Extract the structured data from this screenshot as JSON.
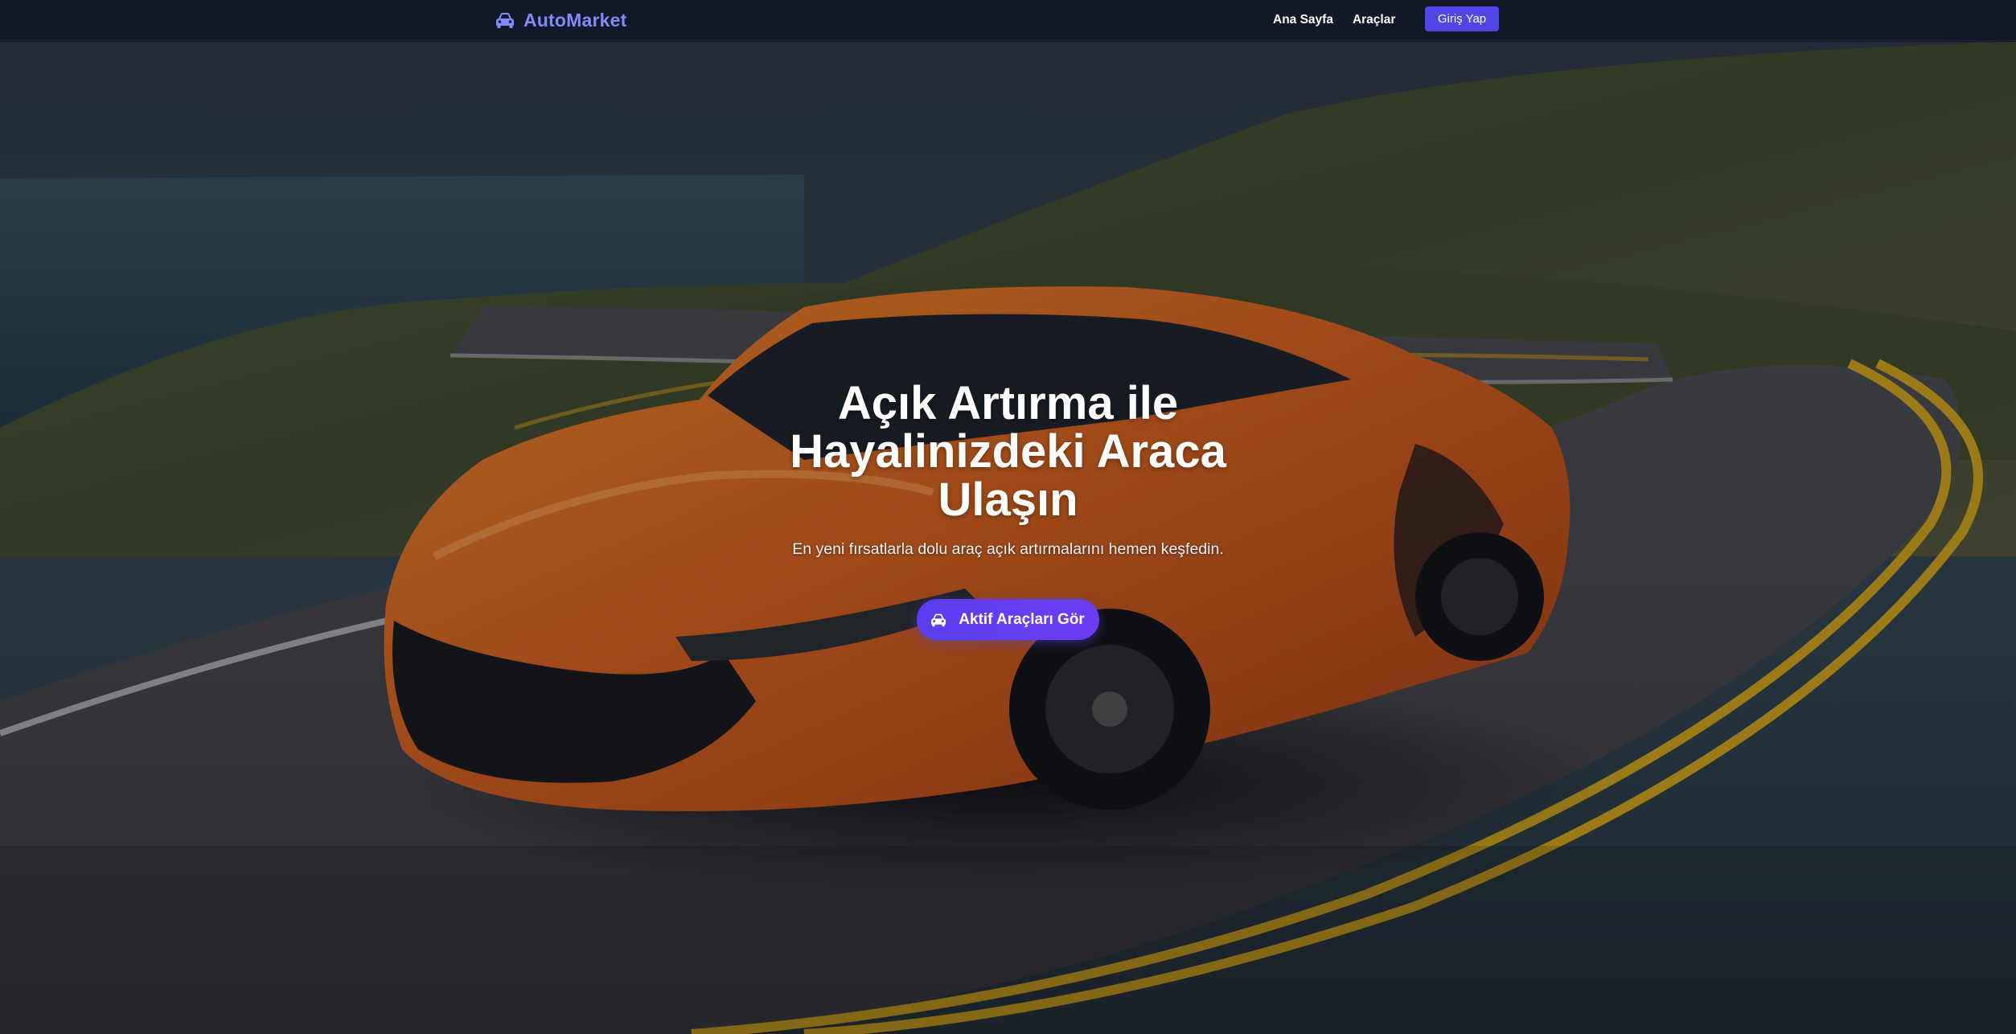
{
  "navbar": {
    "brand": {
      "icon": "car-icon",
      "name": "AutoMarket"
    },
    "links": [
      {
        "label": "Ana Sayfa"
      },
      {
        "label": "Araçlar"
      }
    ],
    "login_label": "Giriş Yap"
  },
  "hero": {
    "background": "orange sports car on winding coastal road",
    "title": "Açık Artırma ile Hayalinizdeki Araca Ulaşın",
    "subtitle": "En yeni fırsatlarla dolu araç açık artırmalarını hemen keşfedin.",
    "cta": {
      "icon": "car-icon",
      "label": "Aktif Araçları Gör"
    }
  },
  "colors": {
    "navbar_bg": "#111827",
    "brand": "#818cf8",
    "accent": "#4f46e5",
    "cta": "#5b3df0",
    "car_orange": "#e2691e",
    "road_line": "#d4a61a"
  }
}
